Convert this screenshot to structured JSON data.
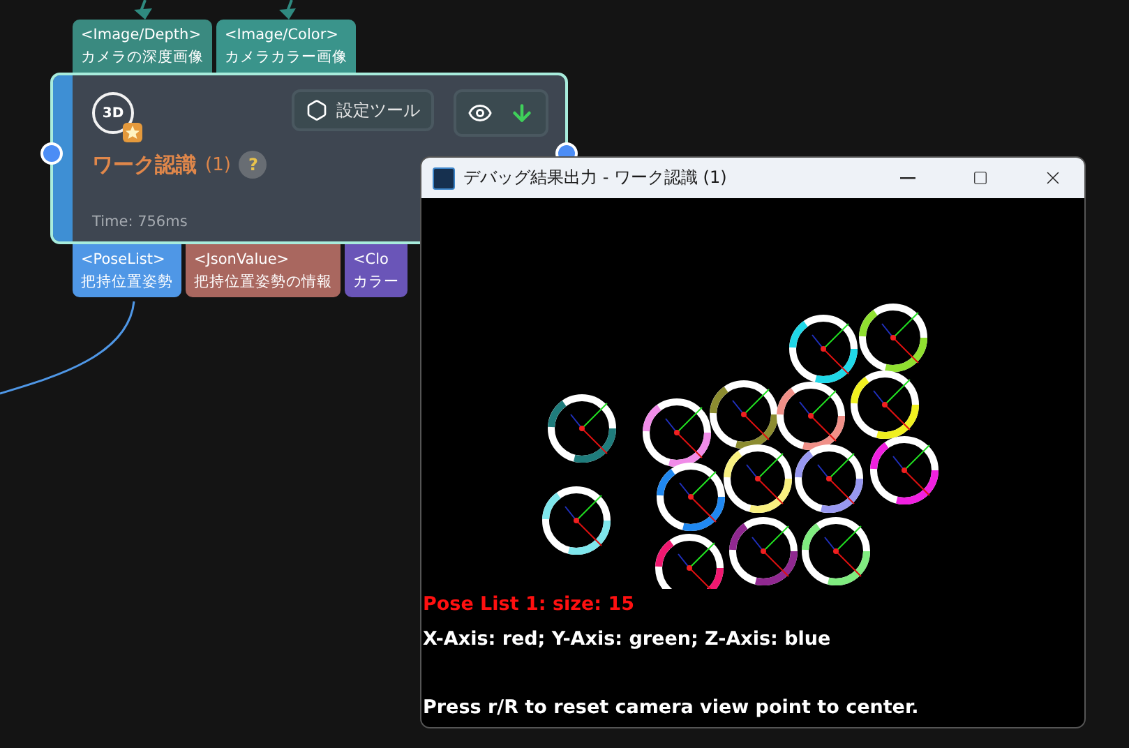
{
  "node": {
    "icon_label": "3D",
    "title": "ワーク認識",
    "count": "(1)",
    "help": "?",
    "time": "Time: 756ms",
    "settings_button": "設定ツール",
    "inputs": [
      {
        "type": "<Image/Depth>",
        "label": "カメラの深度画像",
        "color": "#3a8a80"
      },
      {
        "type": "<Image/Color>",
        "label": "カメラカラー画像",
        "color": "#3a948b"
      }
    ],
    "outputs": [
      {
        "type": "<PoseList>",
        "label": "把持位置姿勢",
        "color": "#4f97e6"
      },
      {
        "type": "<JsonValue>",
        "label": "把持位置姿勢の情報",
        "color": "#a9675f"
      },
      {
        "type": "<Clo",
        "label": "カラー",
        "color": "#6a55b8"
      }
    ]
  },
  "debug_window": {
    "title": "デバッグ結果出力 - ワーク認識 (1)",
    "lines": [
      {
        "text": "Pose List 1: size: 15",
        "kind": "highlight"
      },
      {
        "text": "X-Axis: red; Y-Axis: green; Z-Axis: blue",
        "kind": "plain"
      },
      {
        "text": "Press r/R to reset camera view point to center.",
        "kind": "gap"
      }
    ]
  }
}
